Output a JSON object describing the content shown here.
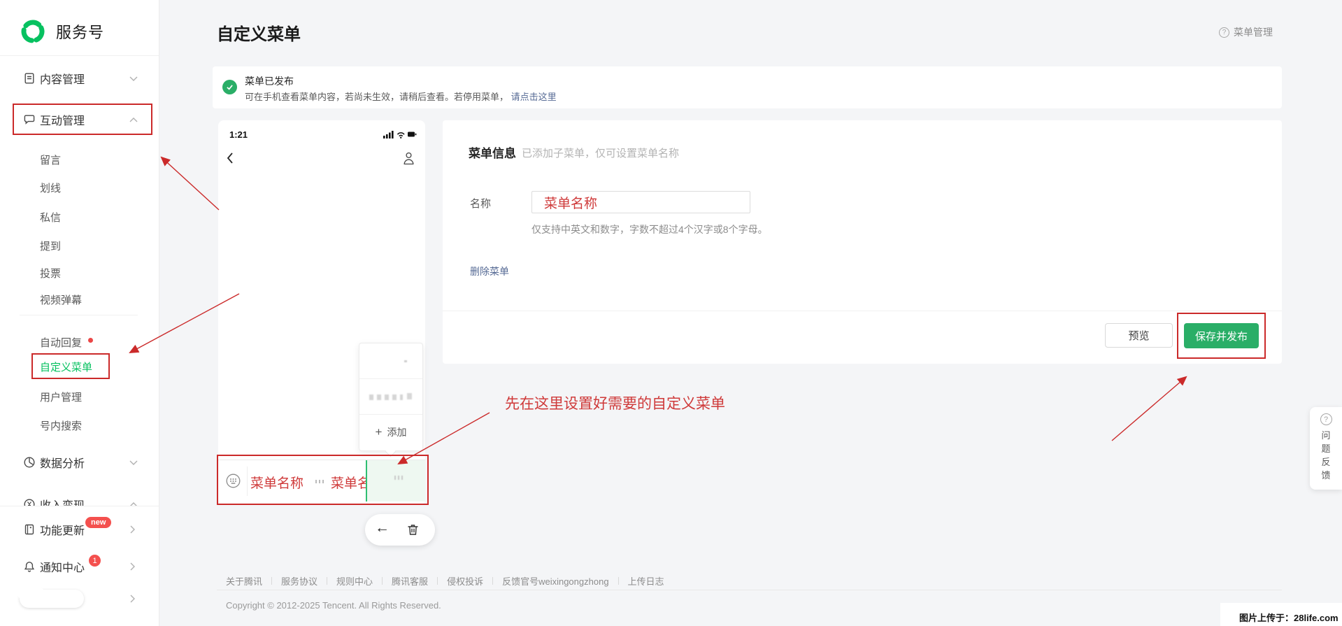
{
  "brand": {
    "name": "服务号"
  },
  "header": {
    "title": "自定义菜单",
    "help": "菜单管理"
  },
  "sidebar": {
    "content_mgmt": "内容管理",
    "interact_mgmt": "互动管理",
    "subs": [
      "留言",
      "划线",
      "私信",
      "提到",
      "投票",
      "视频弹幕"
    ],
    "subs2": [
      "自动回复",
      "自定义菜单",
      "用户管理",
      "号内搜索"
    ],
    "data_analysis": "数据分析",
    "monetization": "收入变现",
    "feature_update": "功能更新",
    "feature_badge": "new",
    "notification": "通知中心",
    "notification_badge": "1"
  },
  "banner": {
    "title": "菜单已发布",
    "body": "可在手机查看菜单内容，若尚未生效，请稍后查看。若停用菜单，",
    "link": "请点击这里"
  },
  "phone": {
    "time": "1:21",
    "plus": "+",
    "add_label": "添加",
    "menu1": "菜单名称",
    "menu2": "菜单名称",
    "back_arrow": "←"
  },
  "form": {
    "heading": "菜单信息",
    "note": "已添加子菜单，仅可设置菜单名称",
    "name_label": "名称",
    "name_value": "菜单名称",
    "helper": "仅支持中英文和数字，字数不超过4个汉字或8个字母。",
    "delete_link": "删除菜单",
    "preview": "预览",
    "save": "保存并发布"
  },
  "annotation": {
    "tip": "先在这里设置好需要的自定义菜单"
  },
  "feedback": {
    "label": "问题反馈"
  },
  "footer": {
    "links": [
      "关于腾讯",
      "服务协议",
      "规则中心",
      "腾讯客服",
      "侵权投诉",
      "反馈官号weixingongzhong",
      "上传日志"
    ],
    "copyright": "Copyright © 2012-2025 Tencent. All Rights Reserved."
  },
  "watermark": {
    "text": "图片上传于：28life.com"
  },
  "icons": {
    "logo": "green-swirl",
    "content_mgmt": "document-icon",
    "interact_mgmt": "chat-bubble-icon",
    "data_analysis": "pie-chart-icon",
    "monetization": "yen-circle-icon",
    "feature_update": "book-icon",
    "notification": "bell-icon",
    "help": "question-circle-icon",
    "banner_status": "check-circle-icon",
    "phone_back": "chevron-left-icon",
    "phone_contact": "person-icon",
    "menubar_left": "keyboard-circle-icon",
    "pill_delete": "trash-icon"
  },
  "colors": {
    "brand_green": "#07c160",
    "button_green": "#2aae67",
    "annotation_red": "#cb2a2a",
    "link_blue": "#576b95",
    "badge_red": "#f4504e"
  }
}
